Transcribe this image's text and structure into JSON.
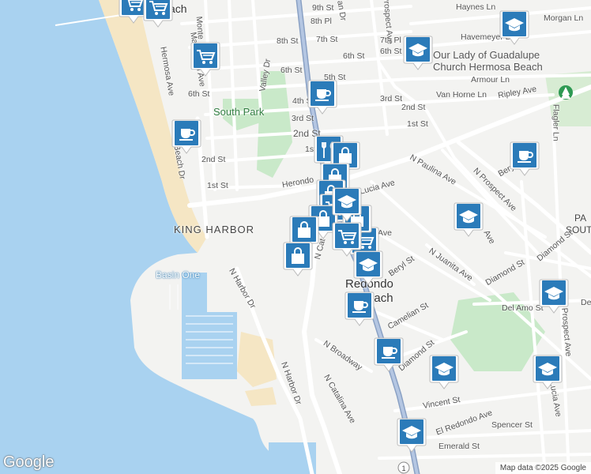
{
  "map": {
    "labels": {
      "king_harbor": "KING HARBOR",
      "basin_one": "Basin One",
      "south_park": "South Park",
      "redondo_beach_1": "Redondo",
      "redondo_beach_2": "Beach",
      "hermosa_beach_top": "ach",
      "church_1": "Our Lady of Guadalupe",
      "church_2": "Church Hermosa Beach",
      "south_east_1": "PA",
      "south_east_2": "SOUTH"
    },
    "streets": {
      "s9th": "9th St",
      "s8th_pl": "8th Pl",
      "s8th": "8th St",
      "s7th": "7th St",
      "s7th_pl": "7th Pl",
      "s6th_a": "6th St",
      "s6th_b": "6th St",
      "s6th_c": "6th St",
      "s5th": "5th St",
      "s4th": "4th St",
      "s3rd_a": "3rd St",
      "s3rd_b": "3rd St",
      "s2nd_a": "2nd St",
      "s2nd_b": "2nd St",
      "s2nd_c": "2nd St",
      "s1st_a": "1st St",
      "s1st_b": "1st",
      "s1st_c": "1st St",
      "haynes": "Haynes Ln",
      "morgan": "Morgan Ln",
      "havemeyer": "Havemeyer Ln",
      "armour": "Armour Ln",
      "vanhorne": "Van Horne Ln",
      "ripley": "Ripley Ave",
      "flagler": "Flagler Ln",
      "manhattan": "Manhattan Ave",
      "hermosa_ave": "Hermosa Ave",
      "valley": "Valley Dr",
      "beach_dr": "Beach Dr",
      "montery": "Monte",
      "herondo": "Herondo",
      "lucia": "Lucia Ave",
      "paulina": "N Paulina Ave",
      "prospect": "N Prospect Ave",
      "prospect2": "Prospect Ave",
      "beryl_a": "Beryl",
      "beryl_b": "Beryl St",
      "juanita": "N Juanita Ave",
      "diamond_a": "Diamond St",
      "diamond_b": "Diamond St",
      "diamond_c": "Diamond St",
      "delamo": "Del Amo St",
      "camelian": "Camelian St",
      "nbroadway": "N Broadway",
      "ncatalina": "N Catalina Ave",
      "ncatalina_top": "N Cat",
      "nharbor_a": "N Harbor Dr",
      "nharbor_b": "N Harbor Dr",
      "vincent": "Vincent St",
      "elredondo": "El Redondo Ave",
      "spencer": "Spencer St",
      "emerald": "Emerald St",
      "lucia_b": "Lucia Ave",
      "ave_a": "Ave",
      "ave_b": "Ave",
      "dan": "an Dr",
      "de": "De",
      "route1": "1"
    },
    "attribution": "Map data ©2025 Google",
    "logo": "Google",
    "colors": {
      "water": "#a9d2f0",
      "sand": "#f5e6c4",
      "park": "#c9e9c9",
      "land": "#f3f3f1",
      "pin": "#2b7bb9",
      "pin_dark": "#1c5a8a"
    },
    "pois": [
      {
        "type": "shopping-cart-icon"
      },
      {
        "type": "shopping-cart-icon"
      },
      {
        "type": "graduation-cap-icon"
      },
      {
        "type": "graduation-cap-icon"
      },
      {
        "type": "coffee-icon"
      },
      {
        "type": "coffee-icon"
      },
      {
        "type": "restaurant-icon"
      },
      {
        "type": "shopping-bag-icon"
      },
      {
        "type": "shopping-bag-icon"
      },
      {
        "type": "shopping-bag-icon"
      },
      {
        "type": "shopping-cart-icon"
      },
      {
        "type": "shopping-bag-icon"
      },
      {
        "type": "shopping-bag-icon"
      },
      {
        "type": "graduation-cap-icon"
      },
      {
        "type": "shopping-cart-icon"
      },
      {
        "type": "coffee-icon"
      },
      {
        "type": "coffee-icon"
      },
      {
        "type": "coffee-icon"
      },
      {
        "type": "graduation-cap-icon"
      },
      {
        "type": "graduation-cap-icon"
      },
      {
        "type": "graduation-cap-icon"
      },
      {
        "type": "graduation-cap-icon"
      },
      {
        "type": "graduation-cap-icon"
      },
      {
        "type": "shopping-bag-icon"
      },
      {
        "type": "shopping-bag-icon"
      },
      {
        "type": "shopping-cart-icon"
      },
      {
        "type": "shopping-cart-icon"
      },
      {
        "type": "graduation-cap-icon"
      }
    ]
  }
}
